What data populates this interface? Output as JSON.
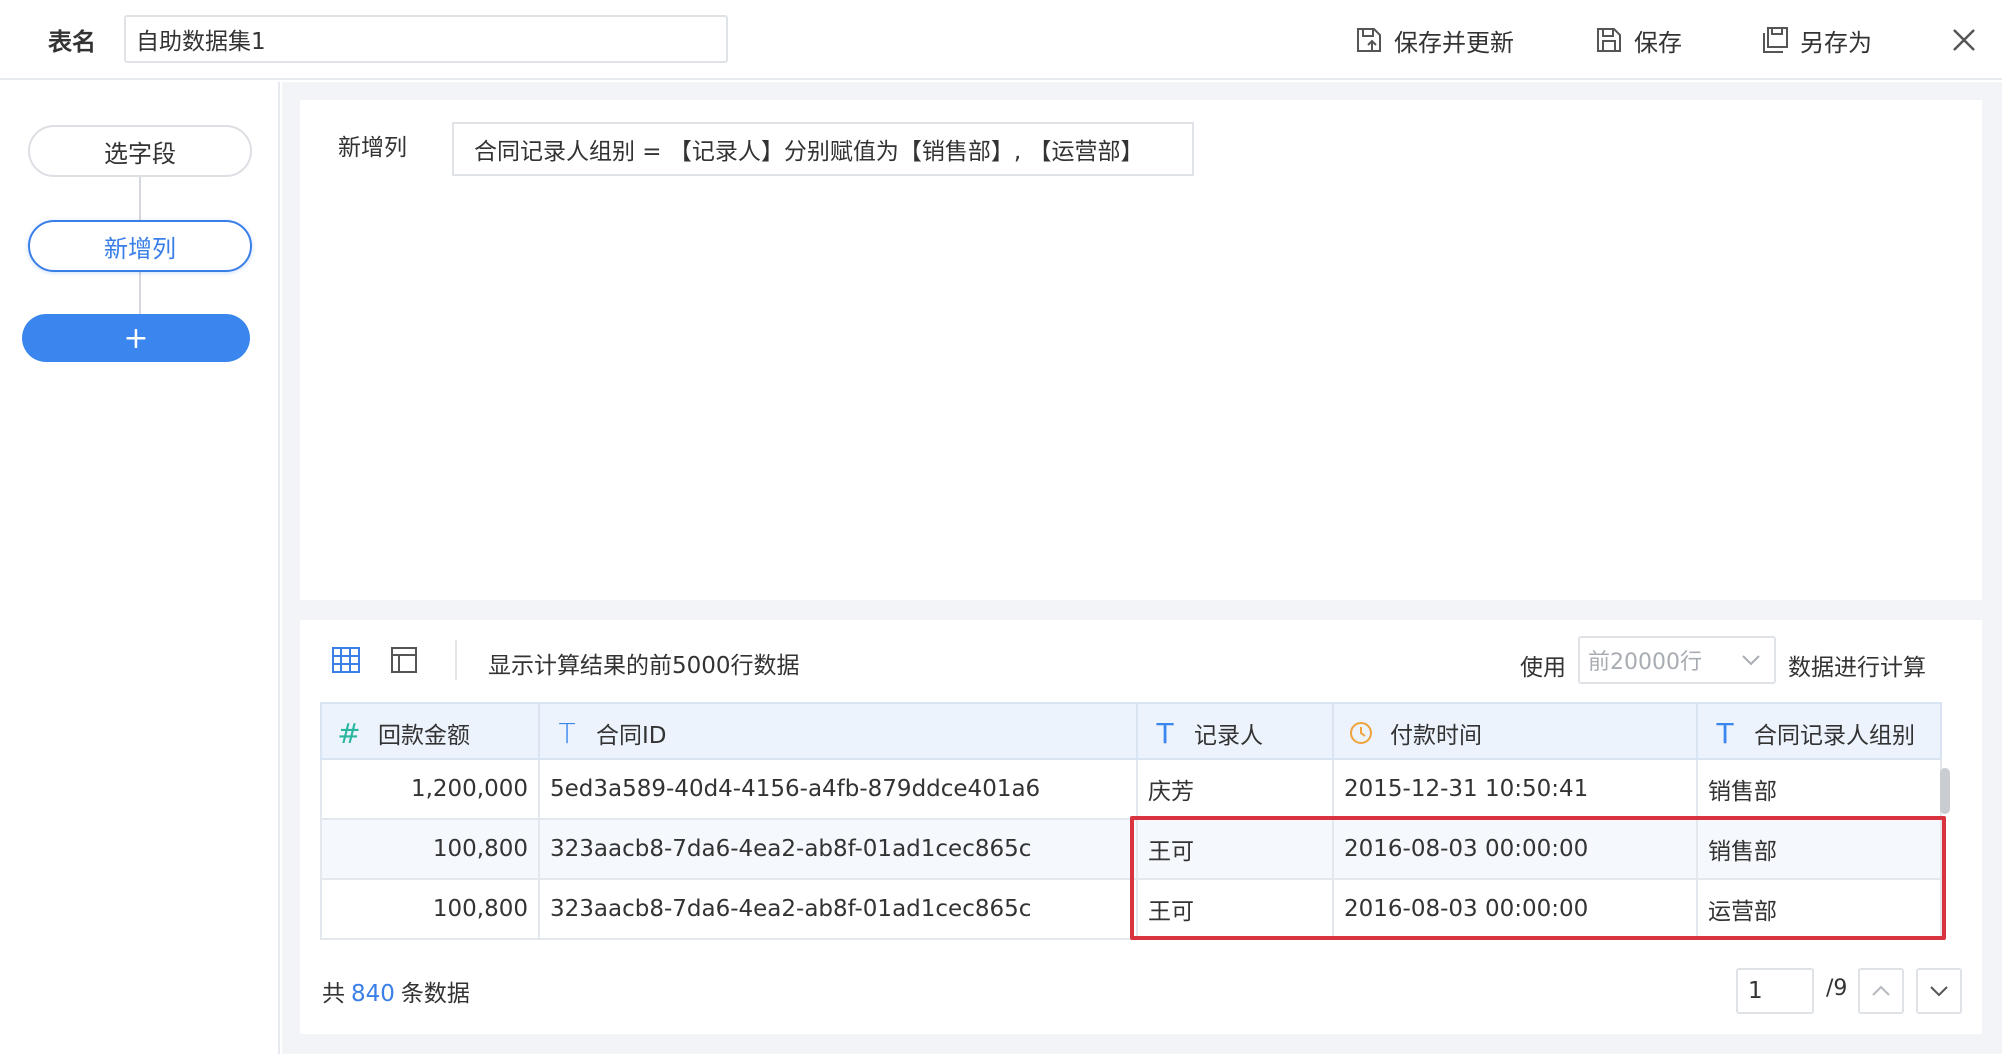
{
  "topbar": {
    "table_name_label": "表名",
    "table_name_value": "自助数据集1",
    "save_update_label": "保存并更新",
    "save_label": "保存",
    "save_as_label": "另存为"
  },
  "sidebar": {
    "steps": [
      {
        "label": "选字段"
      },
      {
        "label": "新增列"
      }
    ],
    "add_label": "+"
  },
  "editor": {
    "label": "新增列",
    "formula": "合同记录人组别 = 【记录人】分别赋值为【销售部】, 【运营部】"
  },
  "preview": {
    "info": "显示计算结果的前5000行数据",
    "use_label": "使用",
    "row_select_value": "前20000行",
    "calc_label": "数据进行计算",
    "columns": [
      {
        "type_icon": "#",
        "label": "回款金额"
      },
      {
        "type_icon": "T",
        "label": "合同ID"
      },
      {
        "type_icon": "T",
        "label": "记录人"
      },
      {
        "type_icon": "clock-icon",
        "label": "付款时间"
      },
      {
        "type_icon": "T",
        "label": "合同记录人组别"
      }
    ],
    "rows": [
      [
        "1,200,000",
        "5ed3a589-40d4-4156-a4fb-879ddce401a6",
        "庆芳",
        "2015-12-31 10:50:41",
        "销售部"
      ],
      [
        "100,800",
        "323aacb8-7da6-4ea2-ab8f-01ad1cec865c",
        "王可",
        "2016-08-03 00:00:00",
        "销售部"
      ],
      [
        "100,800",
        "323aacb8-7da6-4ea2-ab8f-01ad1cec865c",
        "王可",
        "2016-08-03 00:00:00",
        "运营部"
      ]
    ],
    "footer": {
      "total_prefix": "共",
      "total_count": "840",
      "total_suffix": "条数据",
      "page_value": "1",
      "page_total": "/9"
    }
  },
  "colors": {
    "accent": "#3a7fe8",
    "number_icon": "#2bb6a0",
    "text_icon": "#3a86ee",
    "date_icon": "#f0a33a",
    "highlight": "#d9333f"
  }
}
